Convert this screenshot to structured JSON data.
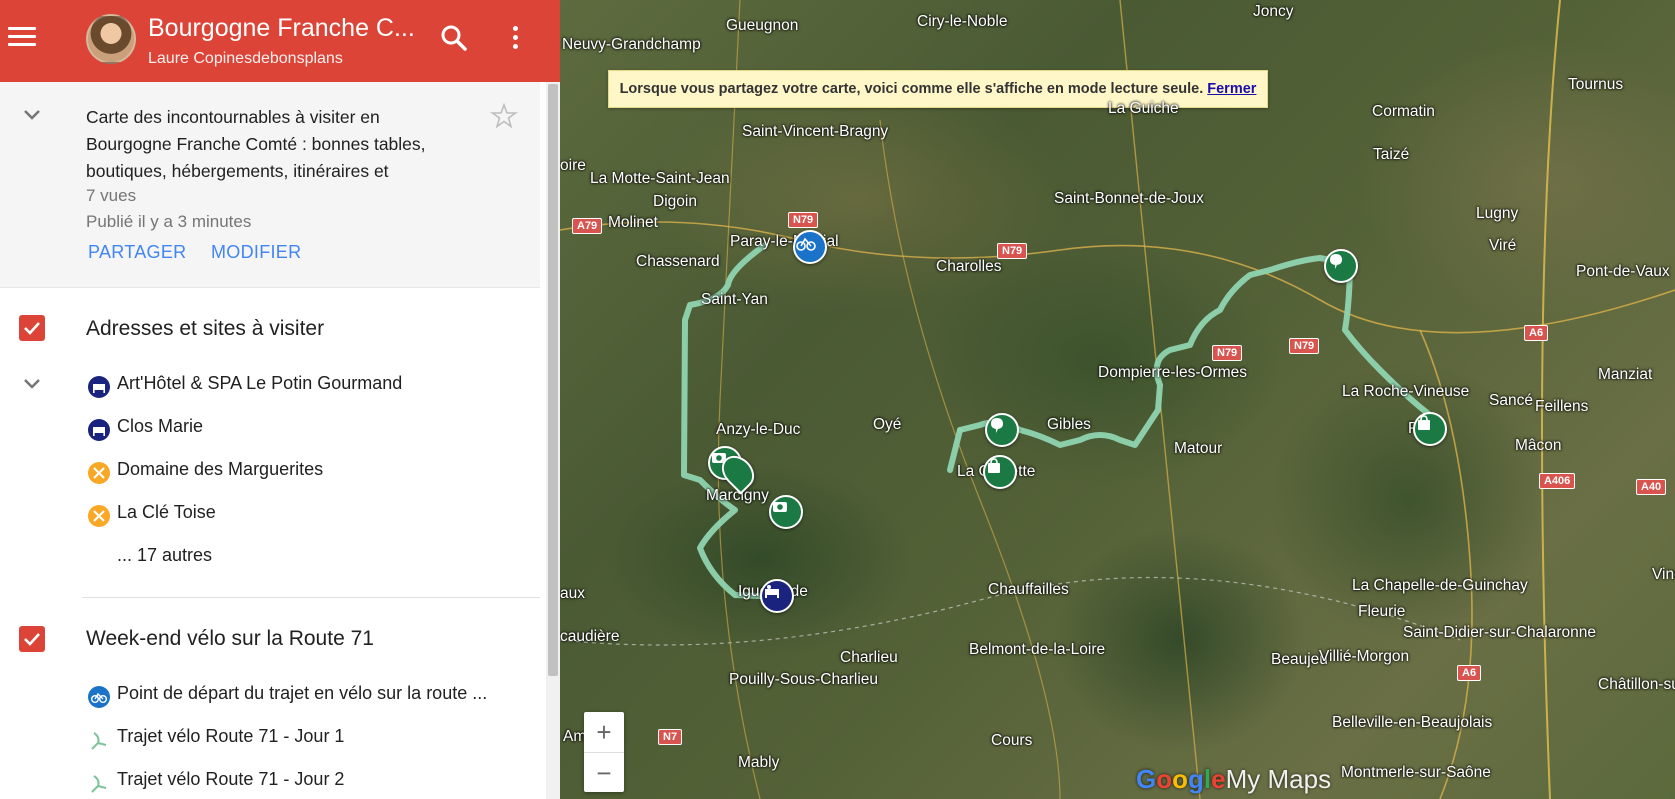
{
  "header": {
    "title": "Bourgogne Franche C...",
    "author": "Laure Copinesdebonsplans"
  },
  "description": {
    "text": "Carte des incontournables à visiter en Bourgogne Franche Comté : bonnes tables, boutiques, hébergements, itinéraires et",
    "views": "7 vues",
    "published": "Publié il y a 3 minutes",
    "share_label": "PARTAGER",
    "edit_label": "MODIFIER"
  },
  "layers": [
    {
      "title": "Adresses et sites à visiter",
      "items": [
        {
          "label": "Art'Hôtel & SPA Le Potin Gourmand",
          "icon": "hotel-icon",
          "color": "#1a237e"
        },
        {
          "label": "Clos Marie",
          "icon": "hotel-icon",
          "color": "#1a237e"
        },
        {
          "label": "Domaine des Marguerites",
          "icon": "restaurant-icon",
          "color": "#f9a825"
        },
        {
          "label": "La Clé Toise",
          "icon": "restaurant-icon",
          "color": "#f9a825"
        }
      ],
      "more": "... 17 autres"
    },
    {
      "title": "Week-end vélo sur la Route 71",
      "items": [
        {
          "label": "Point de départ du trajet en vélo sur la route ...",
          "icon": "bicycle-icon",
          "color": "#1a73c8"
        },
        {
          "label": "Trajet vélo Route 71 - Jour 1",
          "icon": "route-icon",
          "color": "#7cc39a"
        },
        {
          "label": "Trajet vélo Route 71 - Jour 2",
          "icon": "route-icon",
          "color": "#7cc39a"
        }
      ]
    }
  ],
  "map": {
    "banner_text": "Lorsque vous partagez votre carte, voici comme elle s'affiche en mode lecture seule.",
    "banner_link": "Fermer",
    "zoom_in": "+",
    "zoom_out": "−",
    "brand": {
      "g": "G",
      "o1": "o",
      "o2": "o",
      "g2": "g",
      "l": "l",
      "e": "e",
      "mymaps": "My Maps"
    },
    "towns": [
      "Gueugnon",
      "Ciry-le-Noble",
      "Joncy",
      "Neuvy-Grandchamp",
      "La Guiche",
      "Cormatin",
      "Tournus",
      "Saint-Vincent-Bragny",
      "Taizé",
      "La Motte-Saint-Jean",
      "oire",
      "Digoin",
      "Saint-Bonnet-de-Joux",
      "Molinet",
      "Lugny",
      "Viré",
      "Chassenard",
      "Charolles",
      "Pont-de-Vaux",
      "Saint-Yan",
      "Dompierre-les-Ormes",
      "Manziat",
      "La Roche-Vineuse",
      "Sancé",
      "Feillens",
      "Anzy-le-Duc",
      "Oyé",
      "Gibles",
      "Matour",
      "Mâcon",
      "La Clayette",
      "Marcigny",
      "Chauffailles",
      "La Chapelle-de-Guinchay",
      "Iguerande",
      "aux",
      "Fleurie",
      "Saint-Didier-sur-Chalaronne",
      "caudière",
      "Charlieu",
      "Belmont-de-la-Loire",
      "Beaujeu",
      "Villié-Morgon",
      "Pouilly-Sous-Charlieu",
      "Châtillon-sur-Cha",
      "Cours",
      "Belleville-en-Beaujolais",
      "Mably",
      "Montmerle-sur-Saône",
      "Pr",
      "Paray-le-Monial",
      "Am",
      "Vine"
    ],
    "roads": [
      "N79",
      "A79",
      "N79",
      "N79",
      "N79",
      "A6",
      "A406",
      "A40",
      "A6",
      "N7"
    ]
  }
}
